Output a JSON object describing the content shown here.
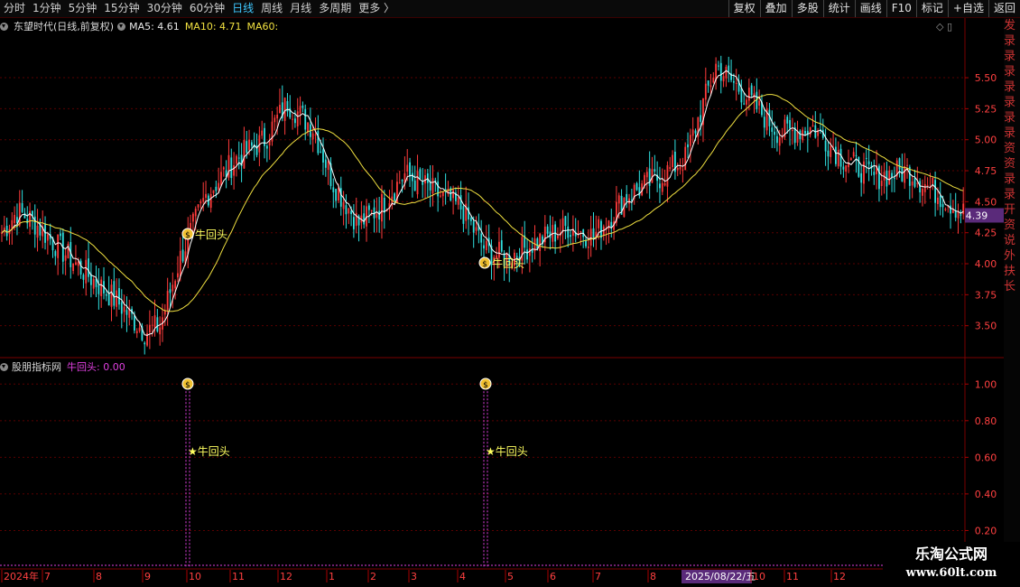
{
  "toolbar": {
    "periods": [
      "分时",
      "1分钟",
      "5分钟",
      "15分钟",
      "30分钟",
      "60分钟",
      "日线",
      "周线",
      "月线",
      "多周期",
      "更多 〉"
    ],
    "active_index": 6,
    "actions": [
      "复权",
      "叠加",
      "多股",
      "统计",
      "画线",
      "F10",
      "标记",
      "+自选",
      "返回"
    ]
  },
  "main_panel": {
    "symbol_label": "东望时代(日线,前复权)",
    "ma5_label": "MA5: 4.61",
    "ma10_label": "MA10: 4.71",
    "ma60_label": "MA60:",
    "price_ticks": [
      "5.50",
      "5.25",
      "5.00",
      "4.75",
      "4.50",
      "4.25",
      "4.00",
      "3.75",
      "3.50"
    ],
    "current_price": "4.39",
    "signal_label": "牛回头",
    "signal_icon": "money-bag-icon"
  },
  "sub_panel": {
    "name": "股朋指标网",
    "indicator_label": "牛回头: 0.00",
    "y_ticks": [
      "1.00",
      "0.80",
      "0.60",
      "0.40",
      "0.20"
    ],
    "signal_label": "★牛回头"
  },
  "date_axis": {
    "labels": [
      "2024年",
      "7",
      "8",
      "9",
      "10",
      "11",
      "12",
      "1",
      "2",
      "3",
      "4",
      "5",
      "6",
      "7",
      "8",
      "2025/08/22/五",
      "10",
      "11",
      "12"
    ],
    "highlight": "2025/08/22/五"
  },
  "right_strip_chars": [
    "发",
    "录",
    "录",
    "录",
    "录",
    "录",
    "录",
    "录",
    "资",
    "资",
    "录",
    "录",
    "开",
    "资",
    "说",
    "外",
    "扶",
    "长"
  ],
  "watermark": {
    "title": "乐淘公式网",
    "url": "www.60lt.com"
  },
  "colors": {
    "up": "#ff3b3b",
    "down": "#30e0e0",
    "ma_short": "#ffffff",
    "ma_long": "#f0e040",
    "indicator": "#e040e0",
    "grid": "#5a0000",
    "price_box": "#5a2a7a"
  },
  "chart_data": {
    "type": "candlestick",
    "price_range": [
      3.25,
      5.85
    ],
    "signal_candle_indices": [
      64,
      168
    ],
    "indicator_range": [
      0,
      1.1
    ]
  }
}
